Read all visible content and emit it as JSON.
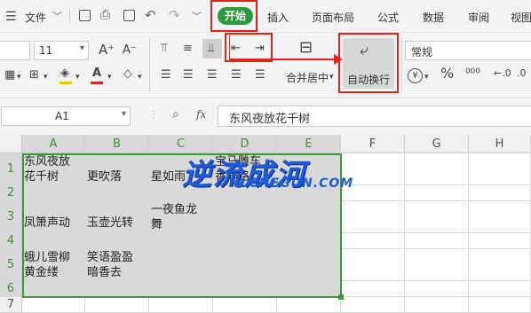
{
  "menu": {
    "file_label": "文件",
    "tabs": [
      {
        "label": "开始",
        "active": true
      },
      {
        "label": "插入"
      },
      {
        "label": "页面布局"
      },
      {
        "label": "公式"
      },
      {
        "label": "数据"
      },
      {
        "label": "审阅"
      },
      {
        "label": "视图"
      }
    ]
  },
  "ribbon": {
    "font_size": "11",
    "increase_font_icon": "A⁺",
    "decrease_font_icon": "A⁻",
    "merge_center_label": "合并居中",
    "wrap_text_label": "自动换行",
    "number_format": "常规",
    "percent_symbol": "%",
    "currency_symbol": "¥"
  },
  "formula_bar": {
    "name_box": "A1",
    "fx_label": "fx",
    "content": "东风夜放花千树"
  },
  "sheet": {
    "columns": [
      "A",
      "B",
      "C",
      "D",
      "E",
      "F",
      "G",
      "H"
    ],
    "rows": [
      "1",
      "2",
      "3",
      "4",
      "5",
      "6",
      "7"
    ],
    "cells": {
      "A1": "东风夜放\n花千树",
      "B1": "更吹落",
      "C1": "星如雨",
      "D1": "宝马雕车\n香满路",
      "A3": "凤箫声动",
      "B3": "玉壶光转",
      "C3": "一夜鱼龙\n舞",
      "A5": "蛾儿雪柳\n黄金缕",
      "B5": "笑语盈盈\n暗香去"
    }
  },
  "watermark": {
    "title": "逆流成河",
    "url": "NLCHEGUN.COM"
  },
  "colors": {
    "highlight_red": "#e0261b",
    "active_tab_green": "#2e9a3e",
    "selection_green": "#3c9a3c",
    "selected_fill": "#d9d9d9"
  }
}
